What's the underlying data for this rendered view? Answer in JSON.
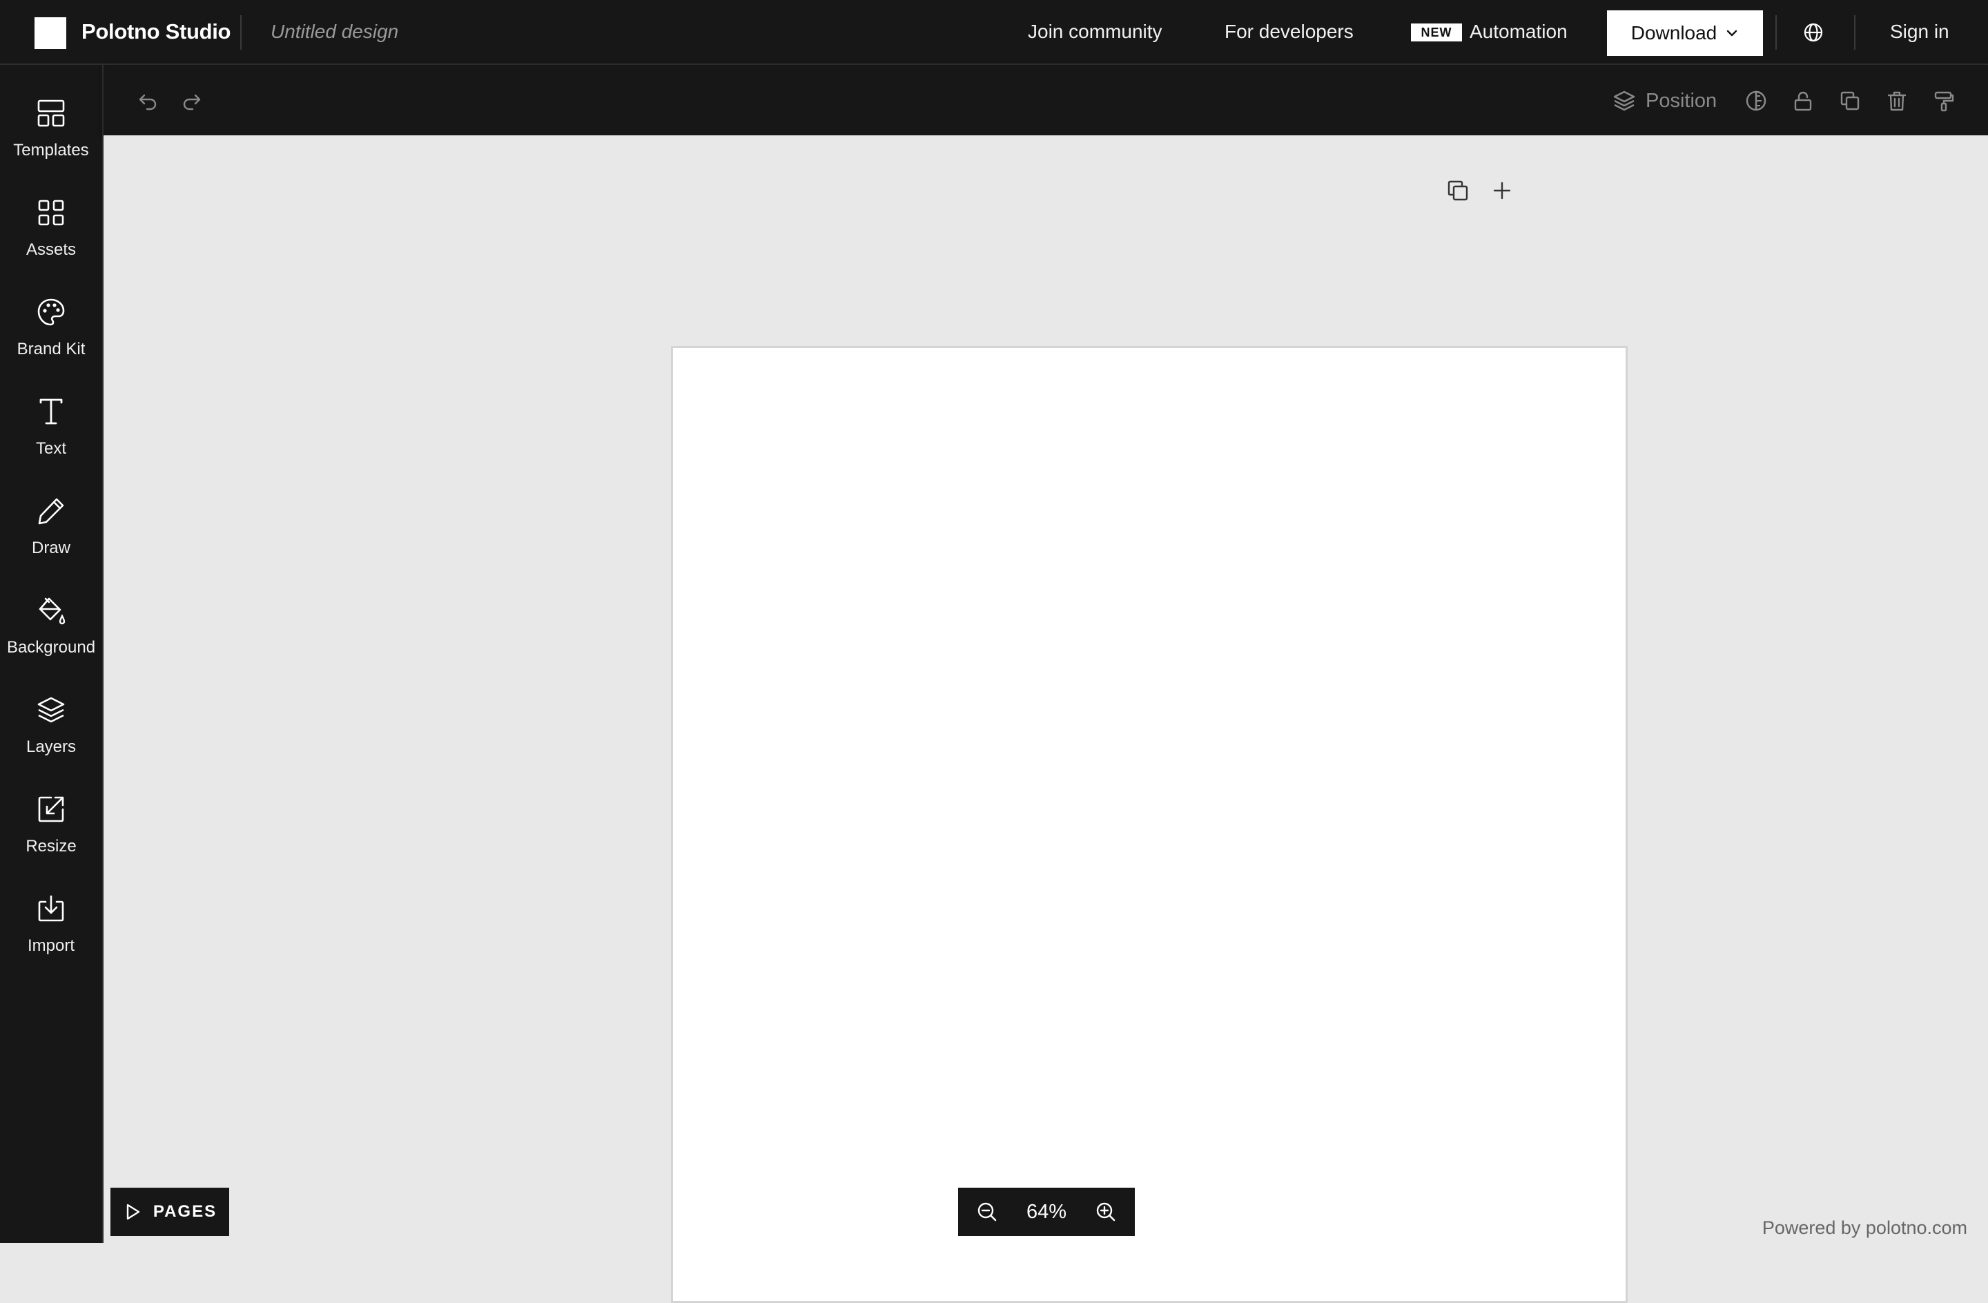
{
  "header": {
    "app_title": "Polotno Studio",
    "design_name": "Untitled design",
    "nav": {
      "join_community": "Join community",
      "for_developers": "For developers",
      "new_badge": "NEW",
      "automation": "Automation",
      "download": "Download",
      "sign_in": "Sign in"
    }
  },
  "sidebar": {
    "items": [
      {
        "label": "Templates",
        "icon": "templates-icon"
      },
      {
        "label": "Assets",
        "icon": "assets-icon"
      },
      {
        "label": "Brand Kit",
        "icon": "palette-icon"
      },
      {
        "label": "Text",
        "icon": "text-icon"
      },
      {
        "label": "Draw",
        "icon": "pencil-icon"
      },
      {
        "label": "Background",
        "icon": "paint-bucket-icon"
      },
      {
        "label": "Layers",
        "icon": "layers-icon"
      },
      {
        "label": "Resize",
        "icon": "resize-icon"
      },
      {
        "label": "Import",
        "icon": "import-icon"
      }
    ]
  },
  "toolbar": {
    "position_label": "Position"
  },
  "footer": {
    "pages_label": "PAGES",
    "zoom_value": "64%",
    "powered_by": "Powered by polotno.com"
  },
  "colors": {
    "chrome": "#171717",
    "workspace": "#e8e8e8",
    "page": "#ffffff",
    "disabled_icon": "#8a8a8a"
  }
}
